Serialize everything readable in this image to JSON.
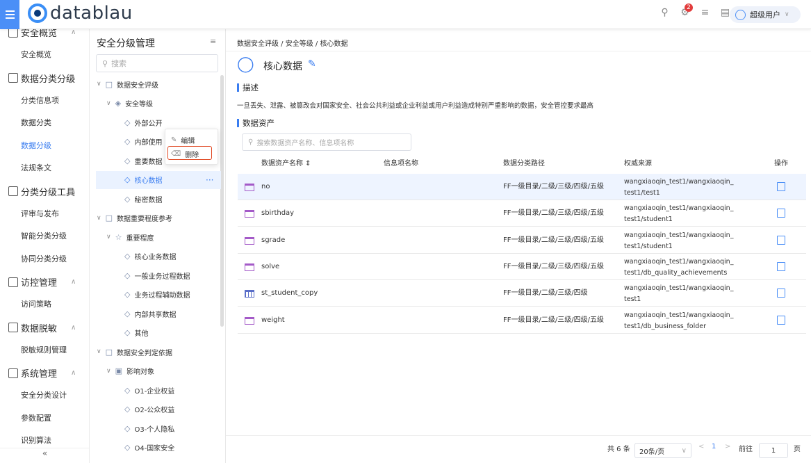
{
  "app": {
    "logo_text": "datablau",
    "user_label": "超级用户",
    "notification_count": "2"
  },
  "leftnav": {
    "groups": [
      {
        "label": "安全概览",
        "items": [
          "安全概览"
        ]
      },
      {
        "label": "数据分类分级",
        "items": [
          "分类信息项",
          "数据分类",
          "数据分级",
          "法规条文"
        ]
      },
      {
        "label": "分类分级工具",
        "items": [
          "评审与发布",
          "智能分类分级",
          "协同分类分级"
        ]
      },
      {
        "label": "访控管理",
        "items": [
          "访问策略"
        ]
      },
      {
        "label": "数据脱敏",
        "items": [
          "脱敏规则管理"
        ]
      },
      {
        "label": "系统管理",
        "items": [
          "安全分类设计",
          "参数配置",
          "识别算法"
        ]
      }
    ],
    "active_item": "数据分级",
    "collapse_symbol": "«"
  },
  "tree": {
    "title": "安全分级管理",
    "search_placeholder": "搜索",
    "nodes": [
      {
        "label": "数据安全评级",
        "depth": 0,
        "kind": "folder"
      },
      {
        "label": "安全等级",
        "depth": 1,
        "kind": "shield"
      },
      {
        "label": "外部公开",
        "depth": 2,
        "kind": "tag"
      },
      {
        "label": "内部使用",
        "depth": 2,
        "kind": "tag"
      },
      {
        "label": "重要数据",
        "depth": 2,
        "kind": "tag"
      },
      {
        "label": "核心数据",
        "depth": 2,
        "kind": "tag",
        "active": true
      },
      {
        "label": "秘密数据",
        "depth": 2,
        "kind": "tag"
      },
      {
        "label": "数据重要程度参考",
        "depth": 0,
        "kind": "folder"
      },
      {
        "label": "重要程度",
        "depth": 1,
        "kind": "star"
      },
      {
        "label": "核心业务数据",
        "depth": 2,
        "kind": "tag"
      },
      {
        "label": "一般业务过程数据",
        "depth": 2,
        "kind": "tag"
      },
      {
        "label": "业务过程辅助数据",
        "depth": 2,
        "kind": "tag"
      },
      {
        "label": "内部共享数据",
        "depth": 2,
        "kind": "tag"
      },
      {
        "label": "其他",
        "depth": 2,
        "kind": "tag"
      },
      {
        "label": "数据安全判定依据",
        "depth": 0,
        "kind": "folder"
      },
      {
        "label": "影响对象",
        "depth": 1,
        "kind": "target"
      },
      {
        "label": "O1-企业权益",
        "depth": 2,
        "kind": "tag"
      },
      {
        "label": "O2-公众权益",
        "depth": 2,
        "kind": "tag"
      },
      {
        "label": "O3-个人隐私",
        "depth": 2,
        "kind": "tag"
      },
      {
        "label": "O4-国家安全",
        "depth": 2,
        "kind": "tag"
      }
    ],
    "context_menu": {
      "edit": "编辑",
      "delete": "删除"
    }
  },
  "main": {
    "breadcrumb": "数据安全评级 / 安全等级 / 核心数据",
    "title": "核心数据",
    "desc_heading": "描述",
    "description": "一旦丢失、泄露、被篡改会对国家安全、社会公共利益或企业利益或用户利益造成特别严重影响的数据，安全管控要求最高",
    "assets_heading": "数据资产",
    "asset_search_placeholder": "搜索数据资产名称、信息项名称",
    "columns": [
      "数据资产名称 ⇕",
      "信息项名称",
      "数据分类路径",
      "权威来源",
      "操作"
    ],
    "rows": [
      {
        "name": "no",
        "info": "",
        "path": "FF一级目录/二级/三级/四级/五级",
        "src1": "wangxiaoqin_test1/wangxiaoqin_",
        "src2": "test1/test1",
        "icon": "table",
        "hl": true
      },
      {
        "name": "sbirthday",
        "info": "",
        "path": "FF一级目录/二级/三级/四级/五级",
        "src1": "wangxiaoqin_test1/wangxiaoqin_",
        "src2": "test1/student1",
        "icon": "table"
      },
      {
        "name": "sgrade",
        "info": "",
        "path": "FF一级目录/二级/三级/四级/五级",
        "src1": "wangxiaoqin_test1/wangxiaoqin_",
        "src2": "test1/student1",
        "icon": "table"
      },
      {
        "name": "solve",
        "info": "",
        "path": "FF一级目录/二级/三级/四级/五级",
        "src1": "wangxiaoqin_test1/wangxiaoqin_",
        "src2": "test1/db_quality_achievements",
        "icon": "table"
      },
      {
        "name": "st_student_copy",
        "info": "",
        "path": "FF一级目录/二级/三级/四级",
        "src1": "wangxiaoqin_test1/wangxiaoqin_",
        "src2": "test1",
        "icon": "grid"
      },
      {
        "name": "weight",
        "info": "",
        "path": "FF一级目录/二级/三级/四级/五级",
        "src1": "wangxiaoqin_test1/wangxiaoqin_",
        "src2": "test1/db_business_folder",
        "icon": "table"
      }
    ],
    "pagination": {
      "total": "共 6 条",
      "page_size": "20条/页",
      "current": "1",
      "goto_label": "前往",
      "goto_value": "1",
      "page_suffix": "页"
    }
  }
}
